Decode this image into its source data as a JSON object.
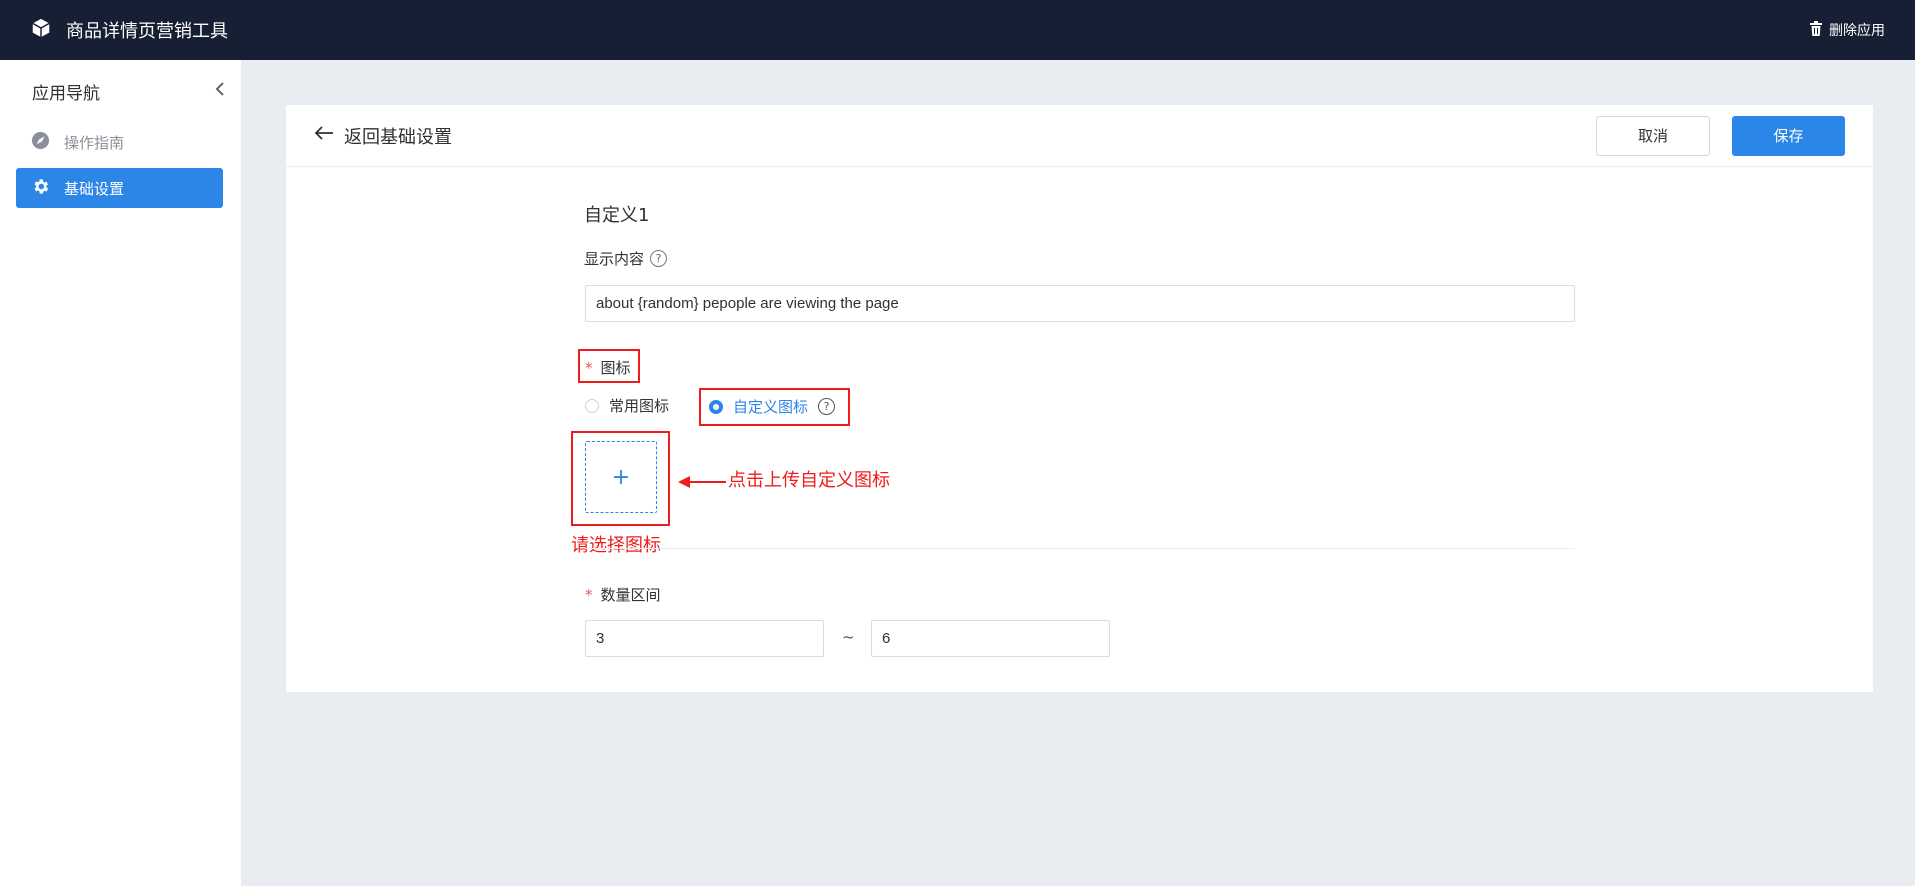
{
  "header": {
    "app_title": "商品详情页营销工具",
    "delete_label": "删除应用"
  },
  "sidebar": {
    "title": "应用导航",
    "items": [
      {
        "label": "操作指南",
        "active": false
      },
      {
        "label": "基础设置",
        "active": true
      }
    ]
  },
  "page": {
    "back_label": "返回基础设置",
    "cancel_label": "取消",
    "save_label": "保存",
    "section_title": "自定义1",
    "display_content": {
      "label": "显示内容",
      "value": "about  {random} pepople are viewing the page"
    },
    "icon": {
      "label": "图标",
      "options": [
        {
          "label": "常用图标",
          "selected": false
        },
        {
          "label": "自定义图标",
          "selected": true
        }
      ],
      "upload_symbol": "+",
      "error_text": "请选择图标"
    },
    "quantity_range": {
      "label": "数量区间",
      "min": "3",
      "separator": "~",
      "max": "6"
    }
  },
  "annotation": {
    "text": "点击上传自定义图标",
    "color": "#ee1c1c"
  },
  "colors": {
    "topbar": "#161f33",
    "accent": "#2b86e8",
    "required": "#f05555"
  }
}
